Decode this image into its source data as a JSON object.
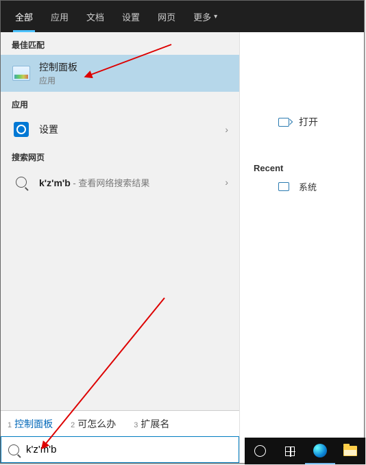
{
  "tabs": {
    "all": "全部",
    "apps": "应用",
    "docs": "文档",
    "settings": "设置",
    "web": "网页",
    "more": "更多"
  },
  "sections": {
    "best_match": "最佳匹配",
    "apps": "应用",
    "search_web": "搜索网页"
  },
  "best": {
    "name": "控制面板",
    "sub": "应用"
  },
  "app_item": {
    "name": "设置"
  },
  "web_item": {
    "query": "k'z'm'b",
    "tail": " - 查看网络搜索结果"
  },
  "right": {
    "open": "打开",
    "recent_hdr": "Recent",
    "recent_item": "系统"
  },
  "suggestions": [
    {
      "n": "1",
      "t": "控制面板",
      "cls": "blue"
    },
    {
      "n": "2",
      "t": "可怎么办",
      "cls": "blk"
    },
    {
      "n": "3",
      "t": "扩展名",
      "cls": "blk"
    }
  ],
  "search_value": "k'z'm'b"
}
